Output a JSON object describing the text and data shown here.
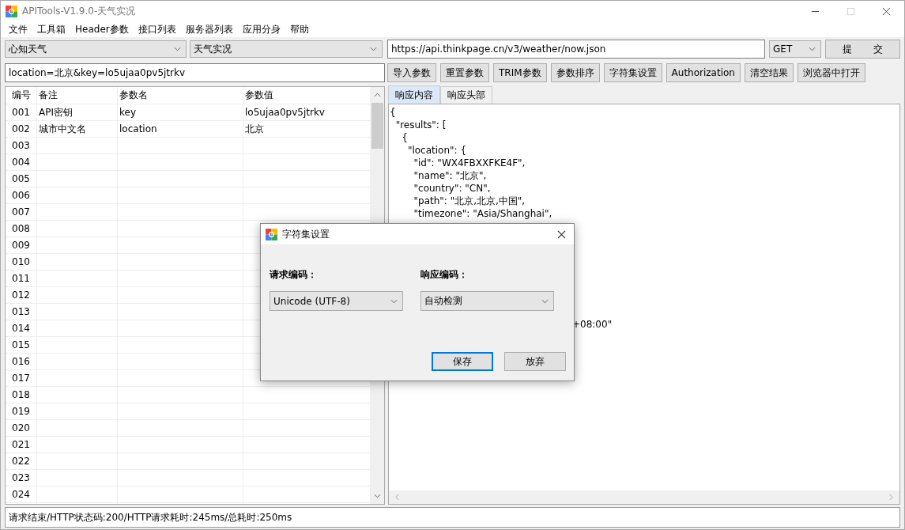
{
  "window": {
    "title": "APITools-V1.9.0-天气实况"
  },
  "menu": [
    "文件",
    "工具箱",
    "Header参数",
    "接口列表",
    "服务器列表",
    "应用分身",
    "帮助"
  ],
  "request": {
    "api_group": "心知天气",
    "api_name": "天气实况",
    "url": "https://api.thinkpage.cn/v3/weather/now.json",
    "method": "GET",
    "submit": "提 交",
    "params": "location=北京&key=lo5ujaa0pv5jtrkv"
  },
  "buttons": [
    "导入参数",
    "重置参数",
    "TRIM参数",
    "参数排序",
    "字符集设置",
    "Authorization",
    "清空结果",
    "浏览器中打开"
  ],
  "table": {
    "columns": [
      "编号",
      "备注",
      "参数名",
      "参数值"
    ],
    "rows": [
      {
        "no": "001",
        "note": "API密钥",
        "name": "key",
        "value": "lo5ujaa0pv5jtrkv"
      },
      {
        "no": "002",
        "note": "城市中文名",
        "name": "location",
        "value": "北京"
      },
      {
        "no": "003"
      },
      {
        "no": "004"
      },
      {
        "no": "005"
      },
      {
        "no": "006"
      },
      {
        "no": "007"
      },
      {
        "no": "008"
      },
      {
        "no": "009"
      },
      {
        "no": "010"
      },
      {
        "no": "011"
      },
      {
        "no": "012"
      },
      {
        "no": "013"
      },
      {
        "no": "014"
      },
      {
        "no": "015"
      },
      {
        "no": "016"
      },
      {
        "no": "017"
      },
      {
        "no": "018"
      },
      {
        "no": "019"
      },
      {
        "no": "020"
      },
      {
        "no": "021"
      },
      {
        "no": "022"
      },
      {
        "no": "023"
      },
      {
        "no": "024"
      }
    ]
  },
  "response": {
    "tabs": [
      {
        "label": "响应内容",
        "selected": true
      },
      {
        "label": "响应头部",
        "selected": false
      }
    ],
    "lines": [
      "{",
      "  \"results\": [",
      "    {",
      "      \"location\": {",
      "        \"id\": \"WX4FBXXFKE4F\",",
      "        \"name\": \"北京\",",
      "        \"country\": \"CN\",",
      "        \"path\": \"北京,北京,中国\",",
      "        \"timezone\": \"Asia/Shanghai\","
    ],
    "covered_line_tail": "+08:00\""
  },
  "status_bar": "请求结束/HTTP状态码:200/HTTP请求耗时:245ms/总耗时:250ms",
  "dialog": {
    "title": "字符集设置",
    "request_label": "请求编码：",
    "request_value": "Unicode (UTF-8)",
    "response_label": "响应编码：",
    "response_value": "自动检测",
    "buttons": [
      {
        "label": "保存",
        "selected": true
      },
      {
        "label": "放弃",
        "selected": false
      }
    ]
  }
}
